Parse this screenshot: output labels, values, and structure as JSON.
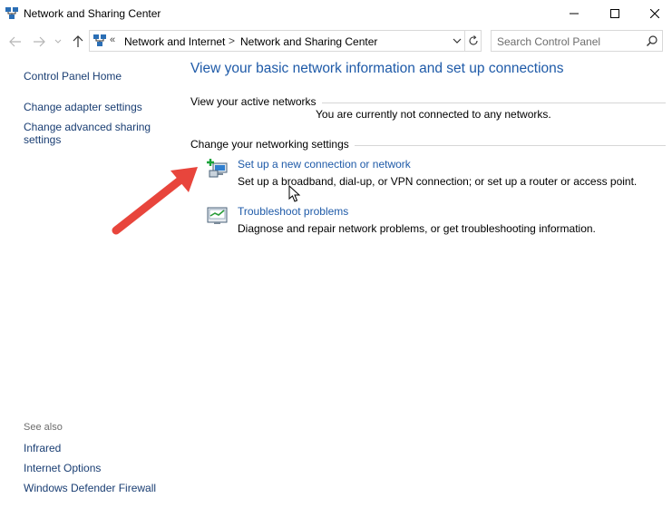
{
  "window": {
    "title": "Network and Sharing Center"
  },
  "address": {
    "overflow": "«",
    "crumbs": [
      "Network and Internet",
      "Network and Sharing Center"
    ],
    "separator": ">"
  },
  "search": {
    "placeholder": "Search Control Panel"
  },
  "sidebar": {
    "home": "Control Panel Home",
    "items": [
      "Change adapter settings",
      "Change advanced sharing settings"
    ],
    "see_also_title": "See also",
    "see_also": [
      "Infrared",
      "Internet Options",
      "Windows Defender Firewall"
    ]
  },
  "main": {
    "headline": "View your basic network information and set up connections",
    "active_networks_title": "View your active networks",
    "active_networks_message": "You are currently not connected to any networks.",
    "settings_title": "Change your networking settings",
    "tasks": [
      {
        "label": "Set up a new connection or network",
        "description": "Set up a broadband, dial-up, or VPN connection; or set up a router or access point.",
        "icon": "new-connection-icon"
      },
      {
        "label": "Troubleshoot problems",
        "description": "Diagnose and repair network problems, or get troubleshooting information.",
        "icon": "troubleshoot-icon"
      }
    ]
  },
  "colors": {
    "link": "#1e5aa8",
    "sidebar_link": "#1a3e73",
    "annotation_arrow": "#e8453c"
  }
}
